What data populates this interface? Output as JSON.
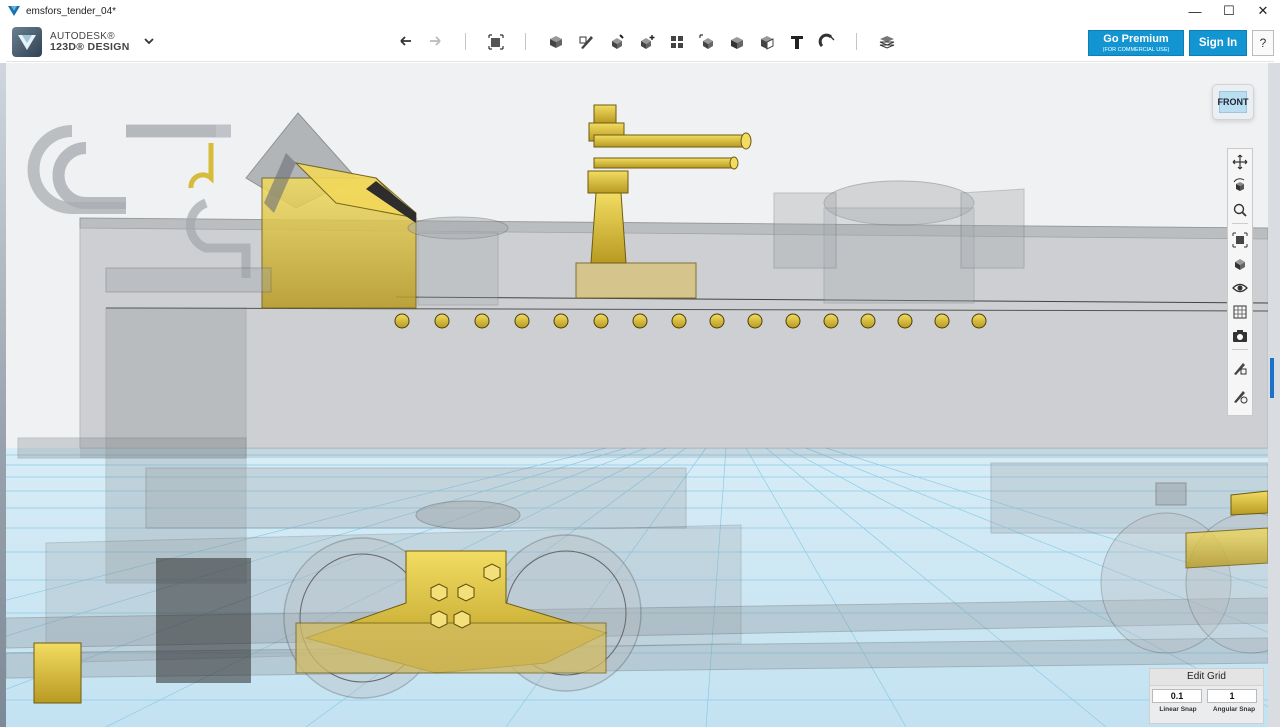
{
  "window": {
    "title": "emsfors_tender_04*",
    "controls": {
      "minimize": "—",
      "maximize": "☐",
      "close": "✕"
    }
  },
  "app": {
    "brand": "AUTODESK®",
    "product": "123D® DESIGN"
  },
  "toolbar": {
    "tools": [
      "undo-icon",
      "redo-icon",
      "transform-icon",
      "primitives-icon",
      "sketch-icon",
      "construct-icon",
      "modify-icon",
      "pattern-icon",
      "grouping-icon",
      "combine-icon",
      "measure-icon",
      "text-icon",
      "snap-icon",
      "material-icon"
    ],
    "go_premium": "Go Premium",
    "go_premium_sub": "(FOR COMMERCIAL USE)",
    "sign_in": "Sign In",
    "help": "?"
  },
  "viewcube": {
    "face": "FRONT"
  },
  "navbar": {
    "items": [
      "pan-icon",
      "orbit-icon",
      "zoom-icon",
      "fit-icon",
      "views-icon",
      "visibility-icon",
      "material-view-icon",
      "screenshot-icon",
      "edit-icon-a",
      "edit-icon-b"
    ]
  },
  "edit_grid": {
    "title": "Edit Grid",
    "linear_snap_value": "0.1",
    "angular_snap_value": "1",
    "linear_snap_label": "Linear Snap",
    "angular_snap_label": "Angular Snap"
  },
  "colors": {
    "accent": "#1295d0",
    "grid_line": "#7fc6e6",
    "gold": "#d9bc3a",
    "glass": "#8f9499"
  }
}
